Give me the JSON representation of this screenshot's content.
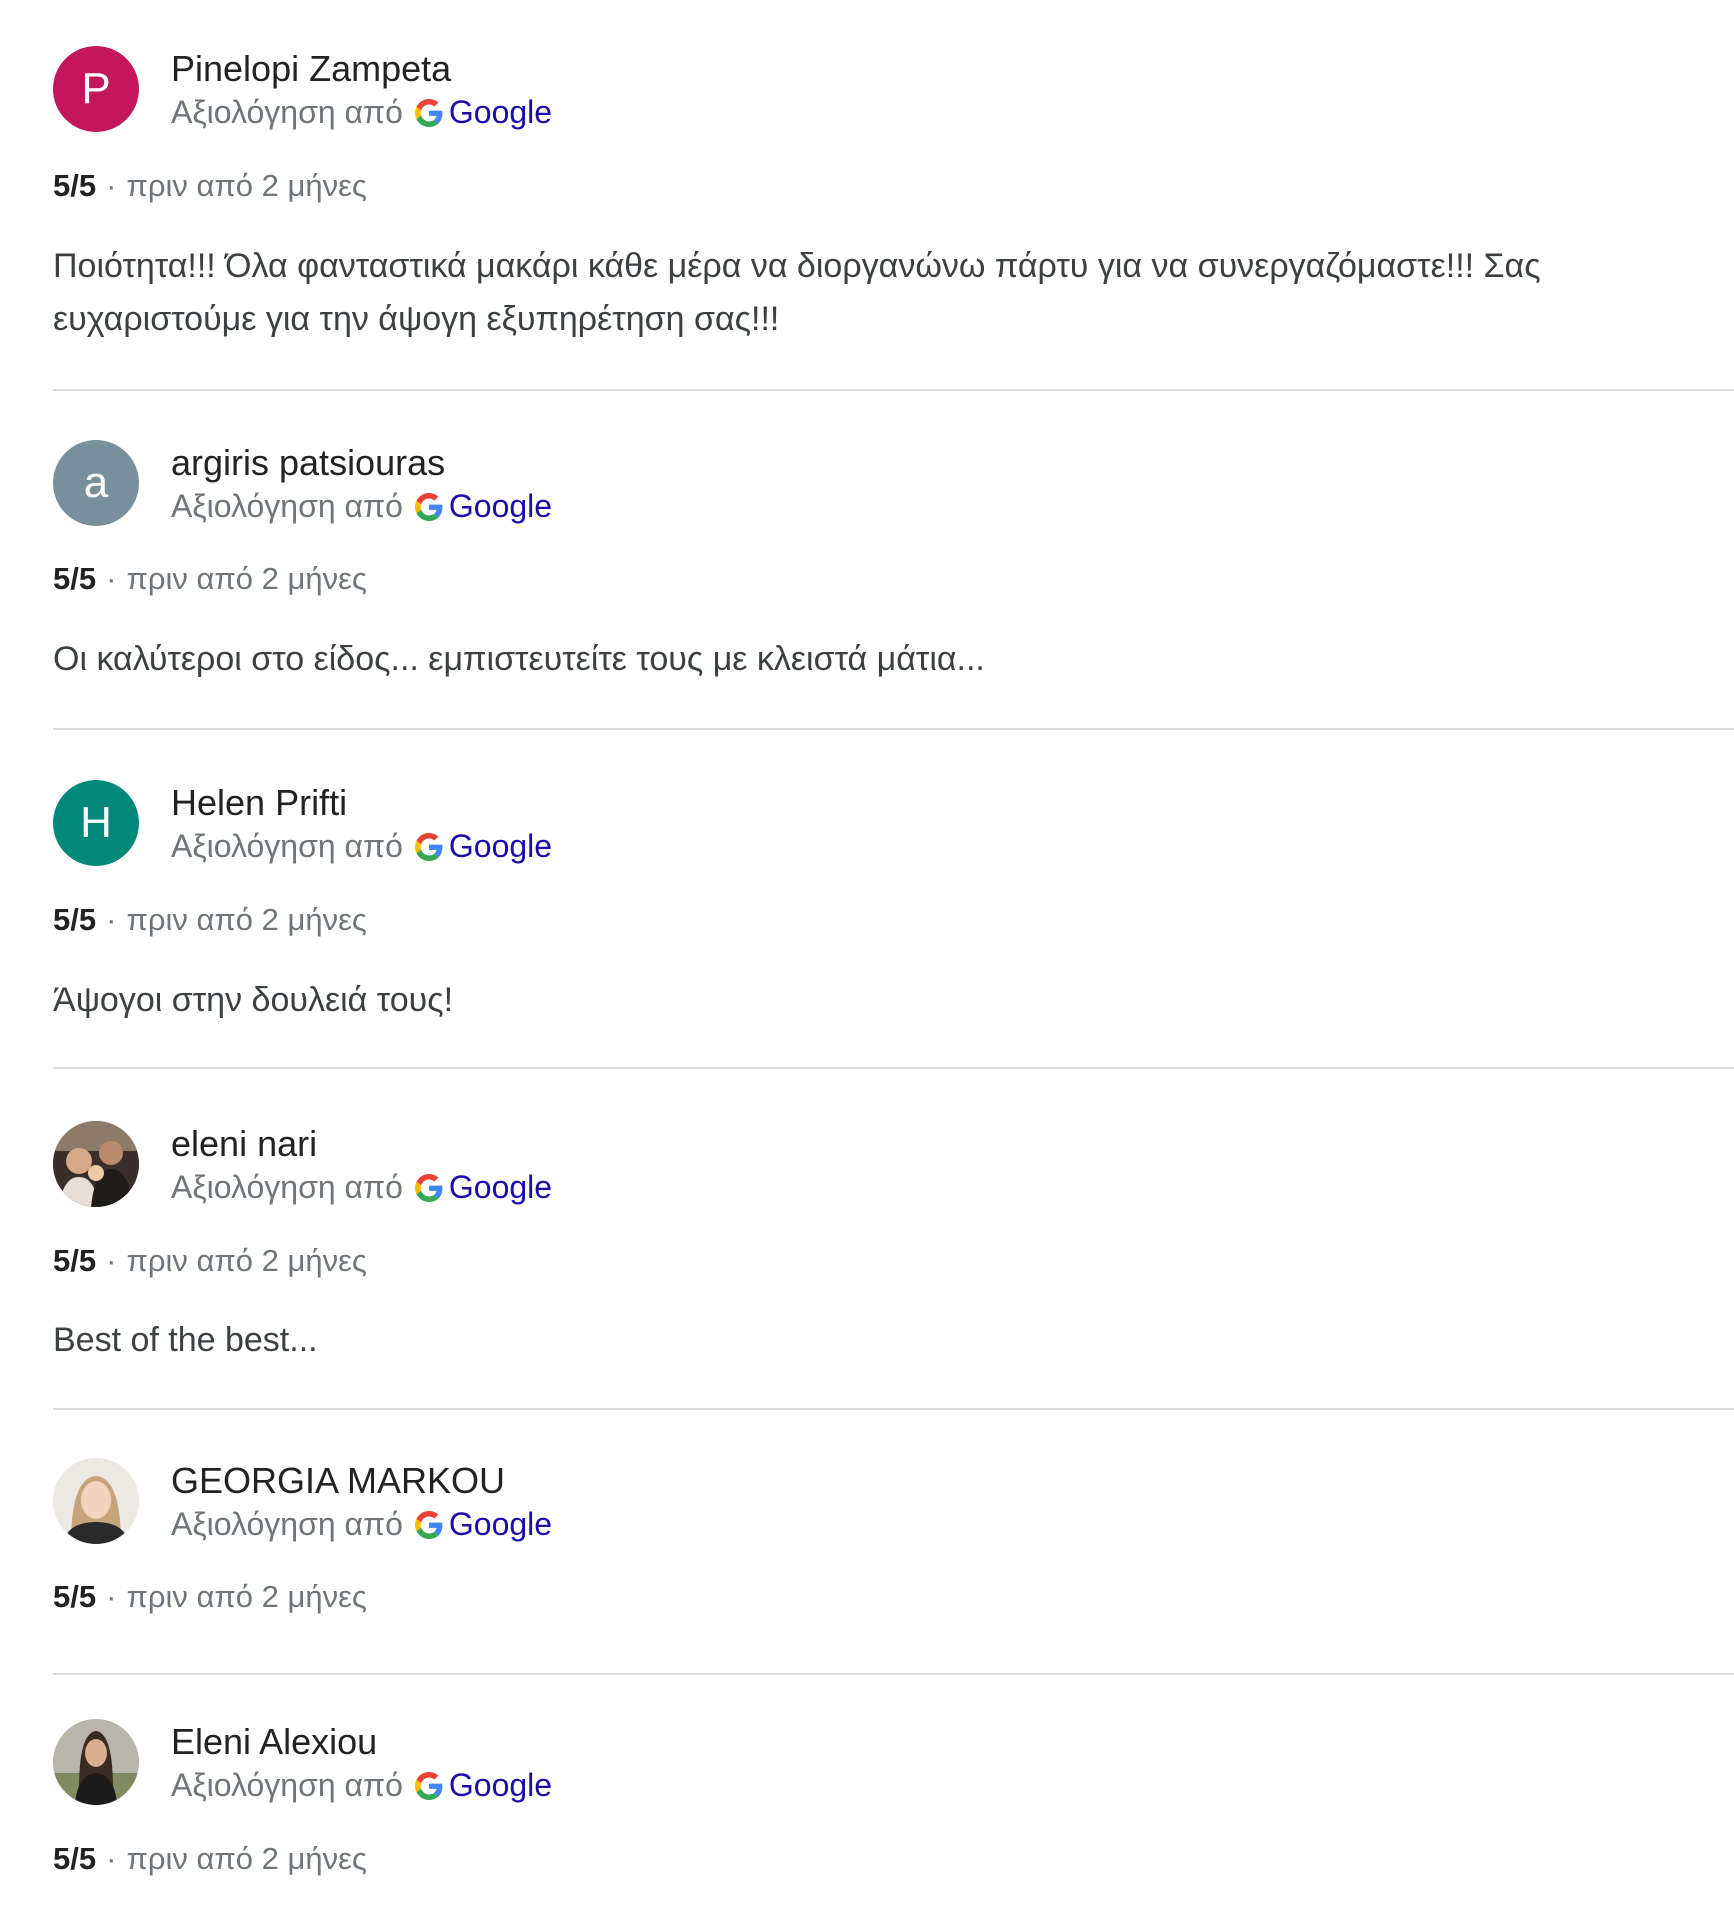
{
  "colors": {
    "avatar_p": "#c2185b",
    "avatar_a": "#78909c",
    "avatar_h": "#00897b",
    "google_link": "#1a0dab",
    "secondary_text": "#70757a",
    "divider": "#dadce0"
  },
  "common": {
    "review_by": "Αξιολόγηση από",
    "google_label": "Google",
    "google_icon": "google-g-icon",
    "separator": "·"
  },
  "reviews": [
    {
      "avatar_letter": "P",
      "name": "Pinelopi Zampeta",
      "rating": "5/5",
      "time": "πριν από 2 μήνες",
      "text": "Ποιότητα!!! Όλα φανταστικά μακάρι κάθε μέρα να διοργανώνω πάρτυ για να συνεργαζόμαστε!!! Σας ευχαριστούμε για την άψογη εξυπηρέτηση σας!!!"
    },
    {
      "avatar_letter": "a",
      "name": "argiris patsiouras",
      "rating": "5/5",
      "time": "πριν από 2 μήνες",
      "text": "Οι καλύτεροι στο είδος... εμπιστευτείτε τους με κλειστά μάτια..."
    },
    {
      "avatar_letter": "H",
      "name": "Helen Prifti",
      "rating": "5/5",
      "time": "πριν από 2 μήνες",
      "text": "Άψογοι στην δουλειά τους!"
    },
    {
      "avatar_letter": "",
      "name": "eleni nari",
      "rating": "5/5",
      "time": "πριν από 2 μήνες",
      "text": "Best of the best..."
    },
    {
      "avatar_letter": "",
      "name": "GEORGIA MARKOU",
      "rating": "5/5",
      "time": "πριν από 2 μήνες",
      "text": ""
    },
    {
      "avatar_letter": "",
      "name": "Eleni Alexiou",
      "rating": "5/5",
      "time": "πριν από 2 μήνες",
      "text": ""
    }
  ]
}
